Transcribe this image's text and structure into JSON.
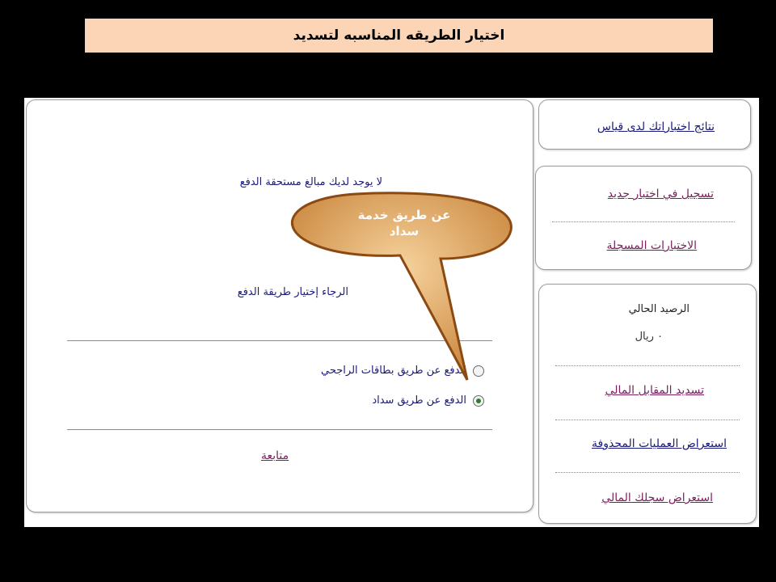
{
  "header": {
    "title": "اختيار الطريقه المناسبه لتسديد"
  },
  "sidebar": {
    "results_link": "نتائج اختباراتك لدى قياس",
    "register_link": "تسجيل في اختبار جديد",
    "registered_tests_link": "الاختبارات المسجلة",
    "balance_label": "الرصيد الحالي",
    "balance_value": "٠ ريال",
    "pay_fee_link": "تسديد المقابل المالي",
    "deleted_ops_link": "استعراض العمليات المحذوفة",
    "financial_record_link": "استعراض سجلك المالي"
  },
  "main": {
    "no_dues_text": "لا يوجد لديك مبالغ مستحقة الدفع",
    "choose_method_text": "الرجاء إختيار طريقة الدفع",
    "payment_options": [
      {
        "label": "الدفع عن طريق بطاقات الراجحي",
        "checked": false
      },
      {
        "label": "الدفع عن طريق سداد",
        "checked": true
      }
    ],
    "continue_link": "متابعة"
  },
  "callout": {
    "line1": "عن طريق خدمة",
    "line2": "سداد"
  },
  "colors": {
    "title_bg": "#fbd5b5",
    "link": "#7a1f5e",
    "text_blue": "#1a1a7a",
    "callout_fill": "#c8843a",
    "callout_stroke": "#8b4a12"
  }
}
